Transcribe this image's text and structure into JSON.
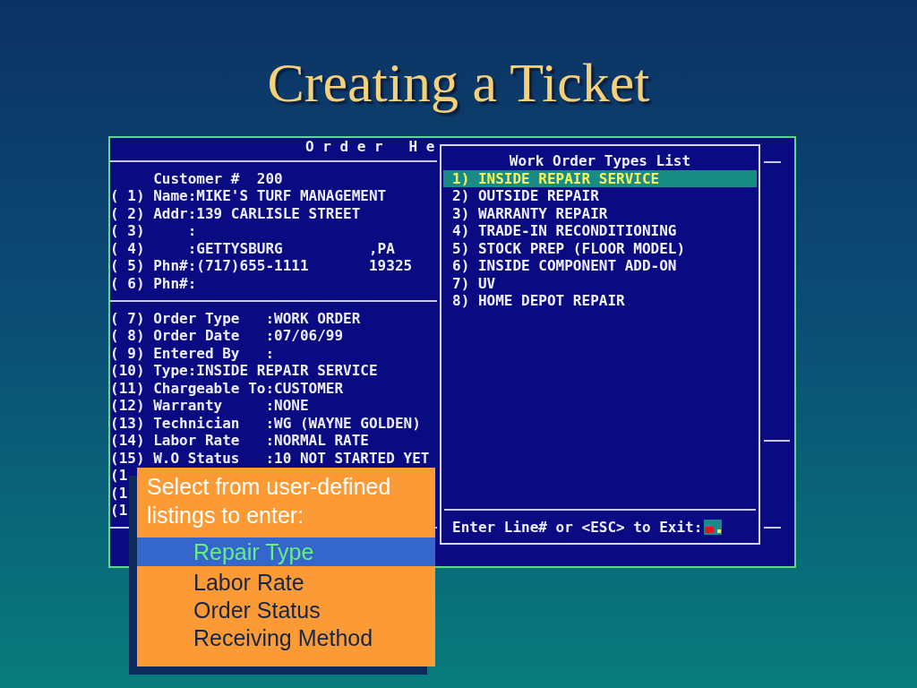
{
  "slide": {
    "title": "Creating a Ticket"
  },
  "order_screen": {
    "header": "O r d e r   H e",
    "customer_line": "Customer #  200",
    "customer_fields": [
      "( 1) Name:MIKE'S TURF MANAGEMENT",
      "( 2) Addr:139 CARLISLE STREET",
      "( 3)     :",
      "( 4)     :GETTYSBURG          ,PA",
      "( 5) Phn#:(717)655-1111       19325",
      "( 6) Phn#:"
    ],
    "order_fields": [
      "( 7) Order Type   :WORK ORDER",
      "( 8) Order Date   :07/06/99",
      "( 9) Entered By   :",
      "(10) Type:INSIDE REPAIR SERVICE",
      "(11) Chargeable To:CUSTOMER",
      "(12) Warranty     :NONE",
      "(13) Technician   :WG (WAYNE GOLDEN)",
      "(14) Labor Rate   :NORMAL RATE",
      "(15) W.O Status   :10 NOT STARTED YET",
      "(1",
      "(1",
      "(1"
    ]
  },
  "types_popup": {
    "title": "Work Order Types List",
    "items": [
      {
        "label": "1) INSIDE REPAIR SERVICE",
        "selected": true
      },
      {
        "label": "2) OUTSIDE REPAIR",
        "selected": false
      },
      {
        "label": "3) WARRANTY REPAIR",
        "selected": false
      },
      {
        "label": "4) TRADE-IN RECONDITIONING",
        "selected": false
      },
      {
        "label": "5) STOCK PREP (FLOOR MODEL)",
        "selected": false
      },
      {
        "label": "6) INSIDE COMPONENT ADD-ON",
        "selected": false
      },
      {
        "label": "7) UV",
        "selected": false
      },
      {
        "label": "8) HOME DEPOT REPAIR",
        "selected": false
      }
    ],
    "prompt": "Enter Line# or <ESC> to Exit:"
  },
  "callout": {
    "text": "Select from user-defined listings to enter:",
    "items": [
      {
        "label": "Repair Type",
        "selected": true
      },
      {
        "label": "Labor Rate",
        "selected": false
      },
      {
        "label": "Order Status",
        "selected": false
      },
      {
        "label": "Receiving Method",
        "selected": false
      }
    ]
  }
}
